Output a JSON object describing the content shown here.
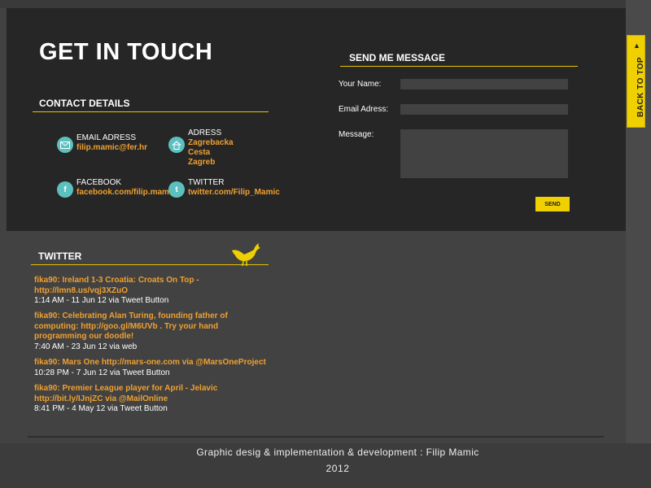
{
  "contact": {
    "title": "GET IN TOUCH",
    "details_heading": "CONTACT DETAILS",
    "items": [
      {
        "label": "EMAIL ADRESS",
        "value": "filip.mamic@fer.hr",
        "icon": "email-icon"
      },
      {
        "label": "ADRESS",
        "value": "Zagrebacka Cesta\nZagreb",
        "icon": "home-icon"
      },
      {
        "label": "FACEBOOK",
        "value": "facebook.com/filip.mamic",
        "icon": "facebook-icon"
      },
      {
        "label": "TWITTER",
        "value": "twitter.com/Filip_Mamic",
        "icon": "twitter-icon"
      }
    ]
  },
  "message_form": {
    "heading": "SEND ME MESSAGE",
    "name_label": "Your Name:",
    "name_value": "",
    "email_label": "Email Adress:",
    "email_value": "",
    "message_label": "Message:",
    "message_value": "",
    "send_label": "SEND"
  },
  "back_to_top": {
    "label": "BACK TO TOP"
  },
  "twitter": {
    "heading": "TWITTER",
    "tweets": [
      {
        "text": "fika90: Ireland 1-3 Croatia: Croats On Top - http://lmn8.us/vqj3XZuO",
        "meta": "1:14 AM - 11 Jun 12 via Tweet Button"
      },
      {
        "text": "fika90: Celebrating Alan Turing, founding father of computing: http://goo.gl/M6UVb . Try your hand programming our doodle!",
        "meta": "7:40 AM - 23 Jun 12 via web"
      },
      {
        "text": "fika90: Mars One http://mars-one.com via @MarsOneProject",
        "meta": "10:28 PM - 7 Jun 12 via Tweet Button"
      },
      {
        "text": "fika90: Premier League player for April - Jelavic http://bit.ly/IJnjZC via @MailOnline",
        "meta": "8:41 PM - 4 May 12 via Tweet Button"
      }
    ]
  },
  "footer": {
    "credit": "Graphic desig & implementation & development : Filip Mamic",
    "year": "2012"
  },
  "colors": {
    "accent_yellow": "#f0d000",
    "link_orange": "#f0a030",
    "icon_teal": "#5bc0be",
    "panel_dark": "#262626",
    "page_grey": "#424242"
  }
}
